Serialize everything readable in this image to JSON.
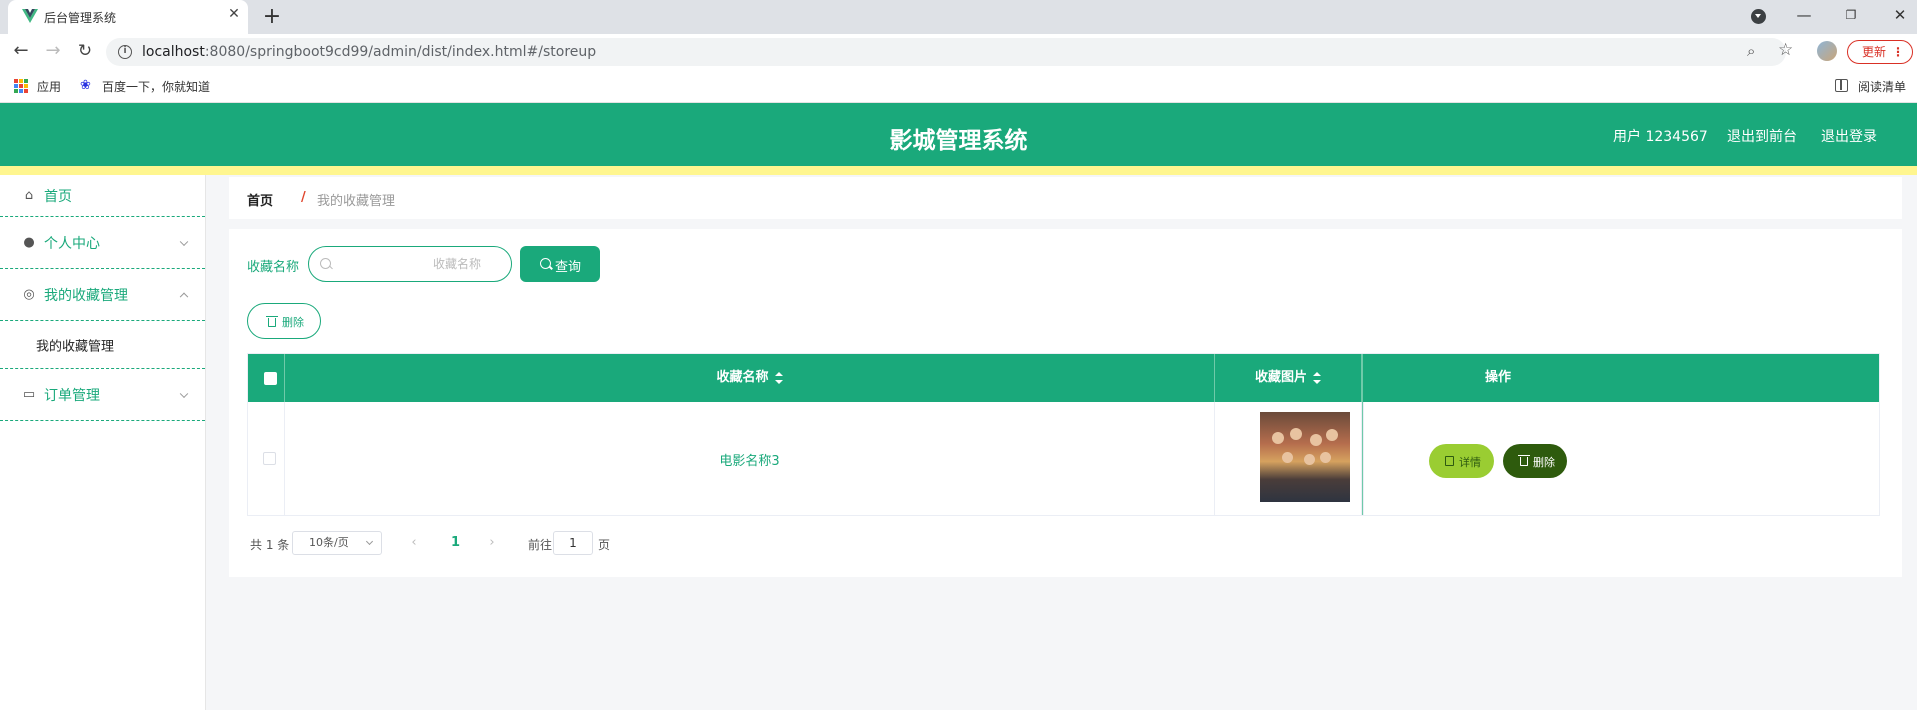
{
  "browser": {
    "tab_title": "后台管理系统",
    "url_host": "localhost",
    "url_path": ":8080/springboot9cd99/admin/dist/index.html#/storeup",
    "update_label": "更新",
    "bookmarks": [
      {
        "label": "应用"
      },
      {
        "label": "百度一下，你就知道"
      }
    ],
    "reading_list": "阅读清单"
  },
  "header": {
    "title": "影城管理系统",
    "user": "用户 1234567",
    "front_link": "退出到前台",
    "logout_link": "退出登录"
  },
  "sidebar": {
    "items": [
      {
        "label": "首页"
      },
      {
        "label": "个人中心"
      },
      {
        "label": "我的收藏管理",
        "children": [
          {
            "label": "我的收藏管理"
          }
        ]
      },
      {
        "label": "订单管理"
      }
    ]
  },
  "breadcrumb": {
    "home": "首页",
    "separator": "/",
    "current": "我的收藏管理"
  },
  "search": {
    "label": "收藏名称",
    "placeholder": "收藏名称",
    "value": "",
    "button": "查询"
  },
  "toolbar": {
    "delete_label": "删除"
  },
  "table": {
    "columns": [
      "收藏名称",
      "收藏图片",
      "操作"
    ],
    "rows": [
      {
        "name": "电影名称3",
        "detail_label": "详情",
        "delete_label": "删除"
      }
    ]
  },
  "pagination": {
    "total": "共 1 条",
    "page_size": "10条/页",
    "current_page": "1",
    "goto_label": "前往",
    "goto_value": "1",
    "page_suffix": "页"
  },
  "colors": {
    "primary": "#1aa97b",
    "stripe": "#fff68f",
    "detail": "#9acd32",
    "danger": "#2e5b0d"
  }
}
